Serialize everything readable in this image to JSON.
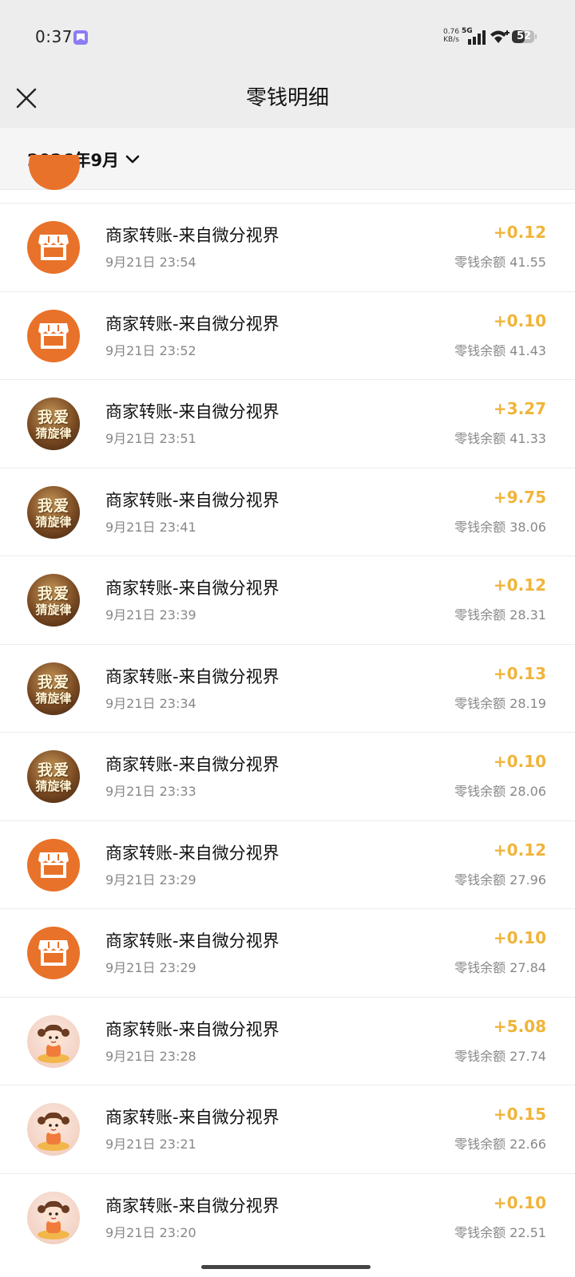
{
  "status_bar": {
    "time": "0:37",
    "net_speed": "0.76",
    "net_unit": "KB/s",
    "network": "5G",
    "battery": "52"
  },
  "header": {
    "title": "零钱明细",
    "close_icon": "close-icon"
  },
  "filter": {
    "month": "2026年9月",
    "chevron_icon": "chevron-down-icon"
  },
  "colors": {
    "amount": "#f0b43a",
    "shop_avatar": "#e8722a",
    "header_bg": "#ededed"
  },
  "transactions": [
    {
      "avatar": "shop",
      "title": "商家转账-来自微分视界",
      "time": "9月21日 23:54",
      "amount": "+0.12",
      "balance": "零钱余额 41.55"
    },
    {
      "avatar": "shop",
      "title": "商家转账-来自微分视界",
      "time": "9月21日 23:52",
      "amount": "+0.10",
      "balance": "零钱余额 41.43"
    },
    {
      "avatar": "music",
      "title": "商家转账-来自微分视界",
      "time": "9月21日 23:51",
      "amount": "+3.27",
      "balance": "零钱余额 41.33"
    },
    {
      "avatar": "music",
      "title": "商家转账-来自微分视界",
      "time": "9月21日 23:41",
      "amount": "+9.75",
      "balance": "零钱余额 38.06"
    },
    {
      "avatar": "music",
      "title": "商家转账-来自微分视界",
      "time": "9月21日 23:39",
      "amount": "+0.12",
      "balance": "零钱余额 28.31"
    },
    {
      "avatar": "music",
      "title": "商家转账-来自微分视界",
      "time": "9月21日 23:34",
      "amount": "+0.13",
      "balance": "零钱余额 28.19"
    },
    {
      "avatar": "music",
      "title": "商家转账-来自微分视界",
      "time": "9月21日 23:33",
      "amount": "+0.10",
      "balance": "零钱余额 28.06"
    },
    {
      "avatar": "shop",
      "title": "商家转账-来自微分视界",
      "time": "9月21日 23:29",
      "amount": "+0.12",
      "balance": "零钱余额 27.96"
    },
    {
      "avatar": "shop",
      "title": "商家转账-来自微分视界",
      "time": "9月21日 23:29",
      "amount": "+0.10",
      "balance": "零钱余额 27.84"
    },
    {
      "avatar": "girl",
      "title": "商家转账-来自微分视界",
      "time": "9月21日 23:28",
      "amount": "+5.08",
      "balance": "零钱余额 27.74"
    },
    {
      "avatar": "girl",
      "title": "商家转账-来自微分视界",
      "time": "9月21日 23:21",
      "amount": "+0.15",
      "balance": "零钱余额 22.66"
    },
    {
      "avatar": "girl",
      "title": "商家转账-来自微分视界",
      "time": "9月21日 23:20",
      "amount": "+0.10",
      "balance": "零钱余额 22.51"
    }
  ],
  "avatar_text": {
    "music_line1": "我爱",
    "music_line2": "猜旋律"
  }
}
